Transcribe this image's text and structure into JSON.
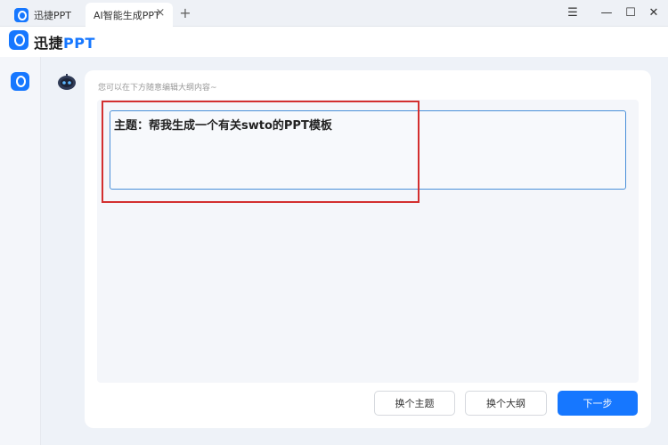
{
  "window": {
    "tabs": [
      {
        "label": "迅捷PPT"
      },
      {
        "label": "AI智能生成PPT"
      }
    ],
    "controls": {
      "menu": "☰",
      "minimize": "—",
      "maximize": "☐",
      "close": "✕"
    }
  },
  "app": {
    "brand_prefix": "迅捷",
    "brand_suffix": "PPT"
  },
  "editor": {
    "hint": "您可以在下方随意编辑大纲内容~",
    "content": "主题：帮我生成一个有关swto的PPT模板"
  },
  "actions": {
    "change_topic": "换个主题",
    "change_outline": "换个大纲",
    "next": "下一步"
  },
  "colors": {
    "accent": "#1677ff",
    "highlight": "#d32f2f"
  }
}
